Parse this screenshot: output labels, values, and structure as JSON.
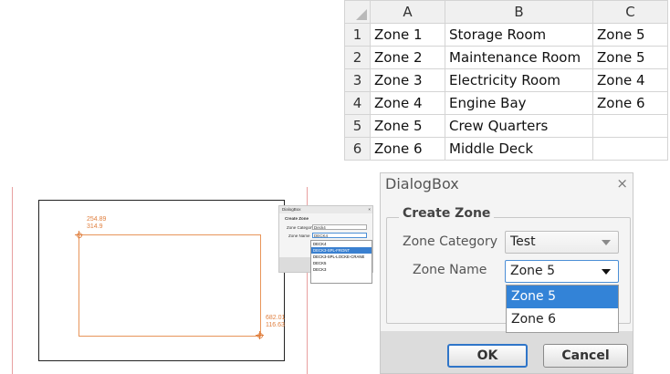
{
  "sheet": {
    "columns": [
      "A",
      "B",
      "C"
    ],
    "rows": [
      {
        "num": "1",
        "a": "Zone 1",
        "b": "Storage Room",
        "c": "Zone 5"
      },
      {
        "num": "2",
        "a": "Zone 2",
        "b": "Maintenance Room",
        "c": "Zone 5"
      },
      {
        "num": "3",
        "a": "Zone 3",
        "b": "Electricity Room",
        "c": "Zone 4"
      },
      {
        "num": "4",
        "a": "Zone 4",
        "b": "Engine Bay",
        "c": "Zone 6"
      },
      {
        "num": "5",
        "a": "Zone 5",
        "b": "Crew Quarters",
        "c": ""
      },
      {
        "num": "6",
        "a": "Zone 6",
        "b": "Middle Deck",
        "c": ""
      }
    ]
  },
  "drawing": {
    "coord_top_x": "254.89",
    "coord_top_y": "314.9",
    "coord_bottom_x": "682.01",
    "coord_bottom_y": "116.63",
    "accent_color": "#e08040"
  },
  "mini_dialog": {
    "title": "DialogBox",
    "close": "×",
    "header": "Create Zone",
    "category_label": "Zone Category",
    "category_value": "Deck4",
    "name_label": "Zone Name",
    "name_value": "DECK4",
    "options": [
      "DECK4",
      "DECK3-SPL-FRONT",
      "DECK3-SPL-LOCKE-CRANE",
      "DECK5",
      "DECK3"
    ],
    "selected_index": 1
  },
  "dialog": {
    "title": "DialogBox",
    "close": "×",
    "group_title": "Create Zone",
    "category_label": "Zone Category",
    "category_value": "Test",
    "name_label": "Zone Name",
    "name_value": "Zone 5",
    "options": [
      "Zone 5",
      "Zone 6"
    ],
    "ok_label": "OK",
    "cancel_label": "Cancel",
    "selection_color": "#3383d7"
  }
}
